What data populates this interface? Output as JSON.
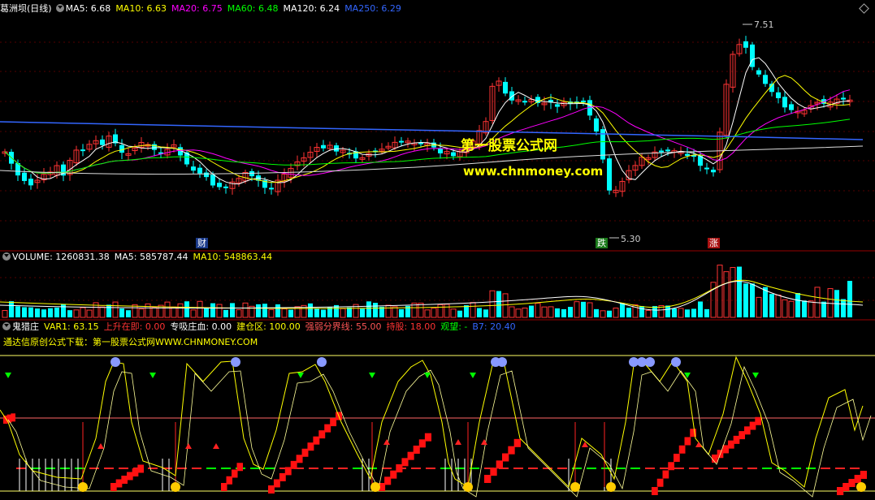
{
  "price_panel": {
    "title": "葛洲坝(日线)",
    "ma": [
      {
        "label": "MA5: 6.68",
        "color": "#ffffff"
      },
      {
        "label": "MA10: 6.63",
        "color": "#ffff00"
      },
      {
        "label": "MA20: 6.75",
        "color": "#ff00ff"
      },
      {
        "label": "MA60: 6.48",
        "color": "#00ff00"
      },
      {
        "label": "MA120: 6.24",
        "color": "#ffffff"
      },
      {
        "label": "MA250: 6.29",
        "color": "#3366ff"
      }
    ],
    "high_label": "7.51",
    "low_label": "5.30",
    "markers": [
      {
        "text": "财",
        "color": "#ffffff",
        "bg": "#1a3a8a"
      },
      {
        "text": "跌",
        "color": "#ffffff",
        "bg": "#1a7a1a"
      },
      {
        "text": "涨",
        "color": "#ffffff",
        "bg": "#aa1111"
      }
    ],
    "watermark_name": "第一股票公式网",
    "watermark_url": "www.chnmoney.com"
  },
  "volume_panel": {
    "items": [
      {
        "label": "VOLUME: 1260831.38",
        "color": "#ffffff"
      },
      {
        "label": "MA5: 585787.44",
        "color": "#ffffff"
      },
      {
        "label": "MA10: 548863.44",
        "color": "#ffff00"
      }
    ]
  },
  "indicator_panel": {
    "items": [
      {
        "label": "鬼猎庄",
        "color": "#ffffff"
      },
      {
        "label": "VAR1: 63.15",
        "color": "#ffff00"
      },
      {
        "label": "上升在即: 0.00",
        "color": "#ff3333"
      },
      {
        "label": "专吸庄血: 0.00",
        "color": "#ffffff"
      },
      {
        "label": "建仓区: 100.00",
        "color": "#ffff00"
      },
      {
        "label": "强弱分界线: 55.00",
        "color": "#ff5555"
      },
      {
        "label": "持股: 18.00",
        "color": "#ff3333"
      },
      {
        "label": "观望: -",
        "color": "#00ff00"
      },
      {
        "label": "B7: 20.40",
        "color": "#3366ff"
      }
    ],
    "subtitle": "通达信原创公式下载：第一股票公式网WWW.CHNMONEY.COM"
  },
  "colors": {
    "up": "#ff3333",
    "down": "#00ffff",
    "frame": "#990000"
  }
}
